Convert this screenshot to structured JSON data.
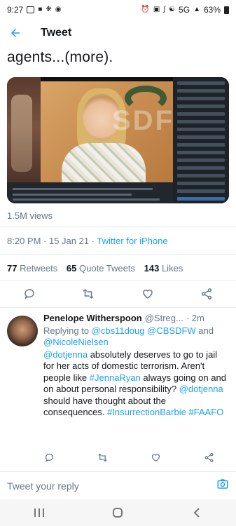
{
  "status_bar": {
    "time": "9:27",
    "network": "5G",
    "battery": "63%"
  },
  "header": {
    "title": "Tweet"
  },
  "tweet": {
    "text_tail": "agents...(more).",
    "video_watermark": "SDFW",
    "views": "1.5M views",
    "timestamp": "8:20 PM · 15 Jan 21 · ",
    "source": "Twitter for iPhone",
    "stats": {
      "retweets_count": "77",
      "retweets_label": "Retweets",
      "quote_count": "65",
      "quote_label": "Quote Tweets",
      "likes_count": "143",
      "likes_label": "Likes"
    }
  },
  "reply": {
    "name": "Penelope Witherspoon",
    "handle": "@Streg...",
    "time": "· 2m",
    "replying_prefix": "Replying to ",
    "mentions": [
      "@cbs11doug",
      "@CBSDFW",
      "@NicoleNielsen"
    ],
    "and_word": " and ",
    "text_parts": {
      "m1": "@dotjenna",
      "t1": " absolutely deserves to go to jail for her acts of domestic terrorism. Aren't people like ",
      "h1": "#JennaRyan",
      "t2": " always going on and on about personal responsibility? ",
      "m2": "@dotjenna",
      "t3": " should have thought about the consequences. ",
      "h2": "#InsurrectionBarbie",
      "t4": " ",
      "h3": "#FAAFO"
    }
  },
  "composer": {
    "placeholder": "Tweet your reply"
  },
  "icons": {
    "back": "arrow-left-icon",
    "reply": "comment-icon",
    "retweet": "retweet-icon",
    "like": "heart-icon",
    "share": "share-icon",
    "camera": "camera-icon"
  },
  "colors": {
    "accent": "#1da1f2",
    "text": "#14171a",
    "secondary": "#657786"
  }
}
